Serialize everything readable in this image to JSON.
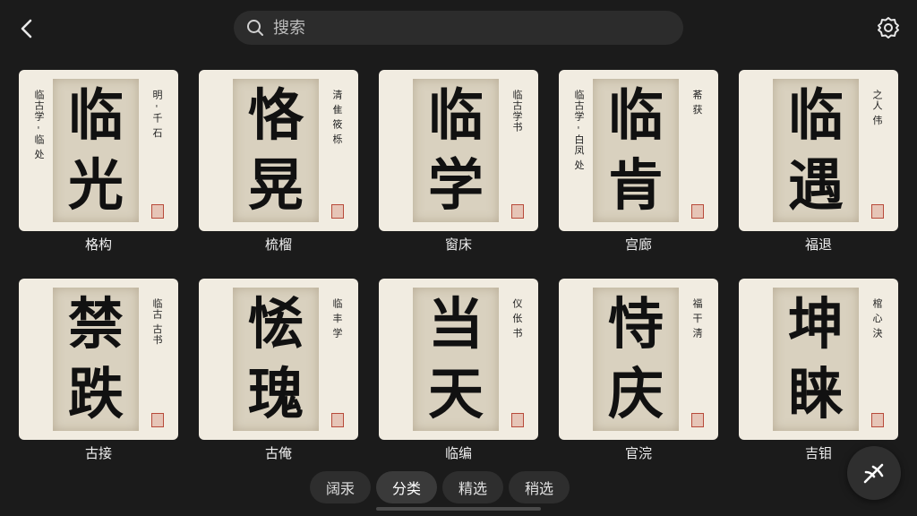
{
  "search": {
    "placeholder": "搜索"
  },
  "cards": [
    {
      "chars": [
        "临",
        "光"
      ],
      "side_left": "临古学 - 临 处",
      "side_right": "明 - 千 石",
      "label": "格构"
    },
    {
      "chars": [
        "恪",
        "晃"
      ],
      "side_left": "",
      "side_right": "清 隹 筱 栎",
      "label": "梳榴"
    },
    {
      "chars": [
        "临",
        "学"
      ],
      "side_left": "",
      "side_right": "临古学书",
      "label": "窗床"
    },
    {
      "chars": [
        "临",
        "肯"
      ],
      "side_left": "临古学 - 白凤 处",
      "side_right": "莃 获",
      "label": "宫廊"
    },
    {
      "chars": [
        "临",
        "遇"
      ],
      "side_left": "",
      "side_right": "之人 伟",
      "label": "福退"
    },
    {
      "chars": [
        "禁",
        "跌"
      ],
      "side_left": "",
      "side_right": "临古 古书",
      "label": "古接"
    },
    {
      "chars": [
        "恡",
        "瑰"
      ],
      "side_left": "",
      "side_right": "临 丰 学",
      "label": "古俺"
    },
    {
      "chars": [
        "当",
        "天"
      ],
      "side_left": "",
      "side_right": "仪 伥 书",
      "label": "临编"
    },
    {
      "chars": [
        "恃",
        "庆"
      ],
      "side_left": "",
      "side_right": "福 干 淸",
      "label": "官浣"
    },
    {
      "chars": [
        "坤",
        "睐"
      ],
      "side_left": "",
      "side_right": "棺 心 決",
      "label": "吉钼"
    }
  ],
  "tabs": [
    {
      "label": "阔汞",
      "active": false
    },
    {
      "label": "分类",
      "active": true
    },
    {
      "label": "精选",
      "active": false
    },
    {
      "label": "稍选",
      "active": false
    }
  ],
  "icons": {
    "back": "chevron-left-icon",
    "search": "search-icon",
    "settings": "gear-icon",
    "fab": "brush-icon"
  }
}
